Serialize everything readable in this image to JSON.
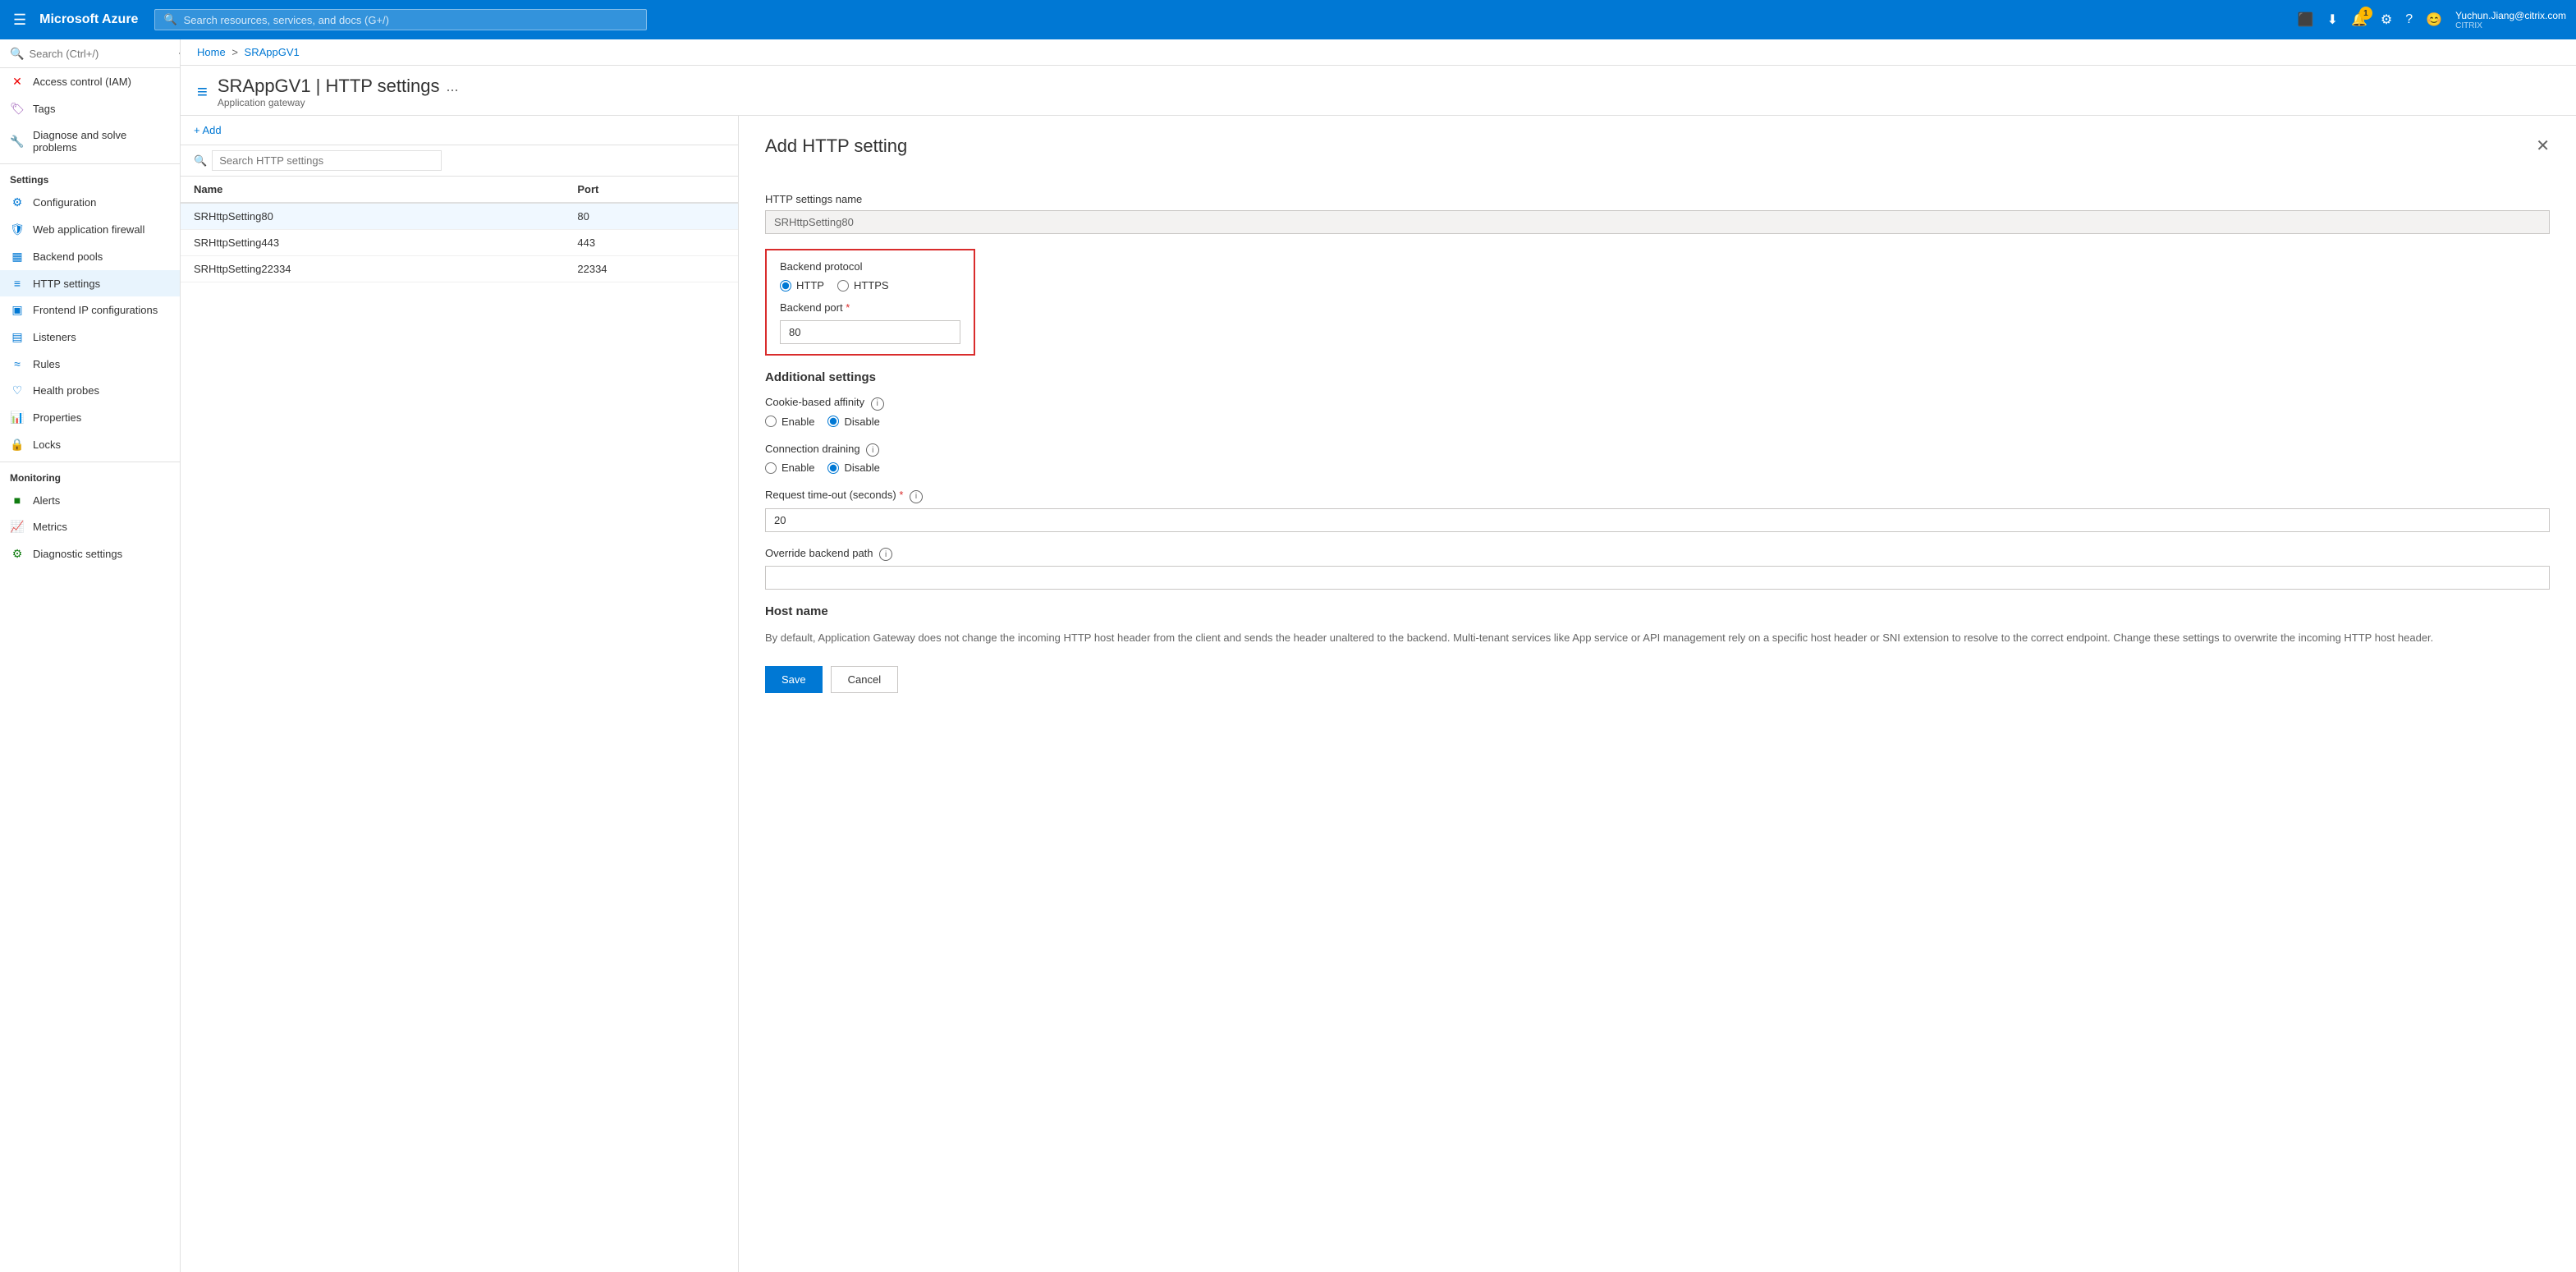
{
  "topnav": {
    "hamburger": "☰",
    "brand": "Microsoft Azure",
    "search_placeholder": "Search resources, services, and docs (G+/)",
    "icons": [
      "⬜",
      "↓",
      "🔔",
      "⚙",
      "?",
      "😊"
    ],
    "notification_count": "1",
    "user_name": "Yuchun.Jiang@citrix.com",
    "user_org": "CITRIX"
  },
  "breadcrumb": {
    "home": "Home",
    "separator1": ">",
    "resource": "SRAppGV1"
  },
  "page_header": {
    "title": "SRAppGV1 | HTTP settings",
    "separator": "|",
    "subtitle": "Application gateway",
    "more": "..."
  },
  "sidebar": {
    "search_placeholder": "Search (Ctrl+/)",
    "items": [
      {
        "id": "access-control",
        "label": "Access control (IAM)",
        "icon": "✕",
        "color": "#e00"
      },
      {
        "id": "tags",
        "label": "Tags",
        "icon": "🏷",
        "color": "#9b59b6"
      },
      {
        "id": "diagnose",
        "label": "Diagnose and solve problems",
        "icon": "🔧",
        "color": "#666"
      }
    ],
    "settings_title": "Settings",
    "settings_items": [
      {
        "id": "configuration",
        "label": "Configuration",
        "icon": "⚙",
        "color": "#0078d4"
      },
      {
        "id": "waf",
        "label": "Web application firewall",
        "icon": "🛡",
        "color": "#0078d4"
      },
      {
        "id": "backend-pools",
        "label": "Backend pools",
        "icon": "▦",
        "color": "#0078d4"
      },
      {
        "id": "http-settings",
        "label": "HTTP settings",
        "icon": "≡",
        "color": "#0078d4",
        "active": true
      },
      {
        "id": "frontend-ip",
        "label": "Frontend IP configurations",
        "icon": "▣",
        "color": "#0078d4"
      },
      {
        "id": "listeners",
        "label": "Listeners",
        "icon": "▤",
        "color": "#0078d4"
      },
      {
        "id": "rules",
        "label": "Rules",
        "icon": "≈",
        "color": "#0078d4"
      },
      {
        "id": "health-probes",
        "label": "Health probes",
        "icon": "♡",
        "color": "#0078d4"
      },
      {
        "id": "properties",
        "label": "Properties",
        "icon": "📊",
        "color": "#0078d4"
      },
      {
        "id": "locks",
        "label": "Locks",
        "icon": "🔒",
        "color": "#0078d4"
      }
    ],
    "monitoring_title": "Monitoring",
    "monitoring_items": [
      {
        "id": "alerts",
        "label": "Alerts",
        "icon": "■",
        "color": "#107c10"
      },
      {
        "id": "metrics",
        "label": "Metrics",
        "icon": "📈",
        "color": "#107c10"
      },
      {
        "id": "diagnostic-settings",
        "label": "Diagnostic settings",
        "icon": "⚙",
        "color": "#107c10"
      }
    ]
  },
  "list_panel": {
    "add_label": "+ Add",
    "search_placeholder": "Search HTTP settings",
    "columns": [
      "Name",
      "Port"
    ],
    "rows": [
      {
        "name": "SRHttpSetting80",
        "port": "80",
        "selected": true
      },
      {
        "name": "SRHttpSetting443",
        "port": "443",
        "selected": false
      },
      {
        "name": "SRHttpSetting22334",
        "port": "22334",
        "selected": false
      }
    ]
  },
  "right_panel": {
    "title": "Add HTTP setting",
    "http_settings_name_label": "HTTP settings name",
    "http_settings_name_value": "SRHttpSetting80",
    "backend_protocol_label": "Backend protocol",
    "protocol_http": "HTTP",
    "protocol_https": "HTTPS",
    "protocol_selected": "HTTP",
    "backend_port_label": "Backend port",
    "backend_port_required": "*",
    "backend_port_value": "80",
    "additional_settings_title": "Additional settings",
    "cookie_affinity_label": "Cookie-based affinity",
    "cookie_affinity_enable": "Enable",
    "cookie_affinity_disable": "Disable",
    "cookie_affinity_selected": "Disable",
    "connection_draining_label": "Connection draining",
    "connection_draining_enable": "Enable",
    "connection_draining_disable": "Disable",
    "connection_draining_selected": "Disable",
    "request_timeout_label": "Request time-out (seconds)",
    "request_timeout_required": "*",
    "request_timeout_value": "20",
    "override_backend_path_label": "Override backend path",
    "override_backend_path_value": "",
    "host_name_title": "Host name",
    "host_name_desc": "By default, Application Gateway does not change the incoming HTTP host header from the client and sends the header unaltered to the backend. Multi-tenant services like App service or API management rely on a specific host header or SNI extension to resolve to the correct endpoint. Change these settings to overwrite the incoming HTTP host header.",
    "save_label": "Save",
    "cancel_label": "Cancel"
  }
}
